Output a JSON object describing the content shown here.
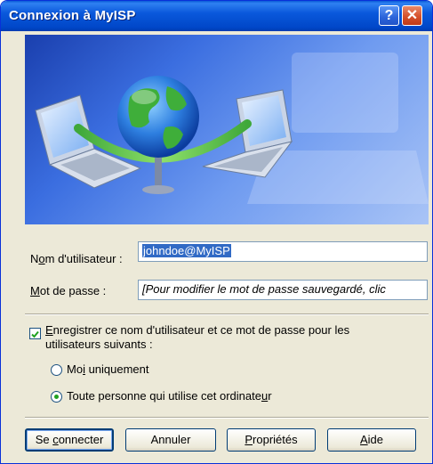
{
  "window": {
    "title": "Connexion à MyISP"
  },
  "titlebar": {
    "help_glyph": "?",
    "close_glyph": "✕"
  },
  "form": {
    "username_label_pre": "N",
    "username_label_key": "o",
    "username_label_post": "m d'utilisateur :",
    "username_value": "johndoe@MyISP",
    "password_label_key": "M",
    "password_label_post": "ot de passe :",
    "password_value": "[Pour modifier le mot de passe sauvegardé, clic"
  },
  "save": {
    "checked": true,
    "label_key": "E",
    "label_line1_post": "nregistrer ce nom d'utilisateur et ce mot de passe pour les",
    "label_line2": "utilisateurs suivants :",
    "option_me_pre": "Mo",
    "option_me_key": "i",
    "option_me_post": " uniquement",
    "option_anyone_pre": "Toute personne qui utilise cet ordinate",
    "option_anyone_key": "u",
    "option_anyone_post": "r",
    "selected": "anyone"
  },
  "buttons": {
    "connect_pre": "Se ",
    "connect_key": "c",
    "connect_post": "onnecter",
    "cancel": "Annuler",
    "props_key": "P",
    "props_post": "ropriétés",
    "help_key": "A",
    "help_post": "ide"
  },
  "colors": {
    "titlebar": "#0a58dc",
    "dialog_bg": "#ece9d8",
    "selection": "#316ac5",
    "radio_dot": "#21a121"
  },
  "icons": {
    "banner": "network-connection-illustration",
    "check": "checkmark-icon"
  }
}
